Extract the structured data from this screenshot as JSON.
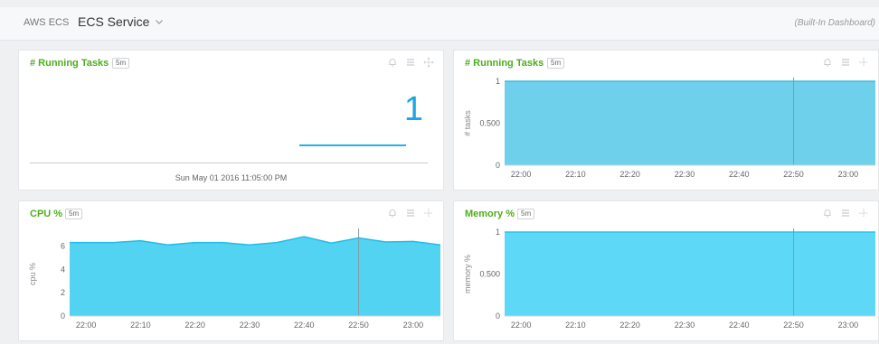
{
  "header": {
    "breadcrumb": "AWS ECS",
    "service": "ECS Service",
    "dashboard_type": "(Built-In Dashboard)"
  },
  "panels": {
    "running_tasks_value": {
      "title": "# Running Tasks",
      "interval": "5m",
      "value": "1",
      "timestamp": "Sun May 01 2016 11:05:00 PM"
    },
    "running_tasks_chart": {
      "title": "# Running Tasks",
      "interval": "5m"
    },
    "cpu_chart": {
      "title": "CPU %",
      "interval": "5m"
    },
    "memory_chart": {
      "title": "Memory %",
      "interval": "5m"
    }
  },
  "colors": {
    "title_green": "#4cae1c",
    "value_blue": "#1fa4e0",
    "area_tasks": "#6fd0ec",
    "area_cpu": "#52d3f2",
    "area_memory": "#5ed8f7"
  },
  "chart_data": [
    {
      "type": "area",
      "id": "running_tasks",
      "title": "# Running Tasks",
      "ylabel": "# tasks",
      "x": [
        "22:00",
        "22:10",
        "22:20",
        "22:30",
        "22:40",
        "22:50",
        "23:00"
      ],
      "xlim": [
        "21:57",
        "23:05"
      ],
      "ylim": [
        0,
        1
      ],
      "yticks": [
        0,
        0.5,
        1
      ],
      "ytick_labels": [
        "0",
        "0.500",
        "1"
      ],
      "series": [
        {
          "x": [
            "21:57",
            "23:05"
          ],
          "values": [
            1,
            1
          ]
        }
      ],
      "marker_x": "22:50",
      "grid": true
    },
    {
      "type": "area",
      "id": "cpu",
      "title": "CPU %",
      "ylabel": "cpu %",
      "x": [
        "22:00",
        "22:10",
        "22:20",
        "22:30",
        "22:40",
        "22:50",
        "23:00"
      ],
      "xlim": [
        "21:57",
        "23:05"
      ],
      "ylim": [
        0,
        7.2
      ],
      "yticks": [
        0,
        2,
        4,
        6
      ],
      "ytick_labels": [
        "0",
        "2",
        "4",
        "6"
      ],
      "series": [
        {
          "x": [
            "21:57",
            "22:05",
            "22:10",
            "22:15",
            "22:20",
            "22:25",
            "22:30",
            "22:35",
            "22:40",
            "22:45",
            "22:50",
            "22:55",
            "23:00",
            "23:05"
          ],
          "values": [
            6.3,
            6.3,
            6.45,
            6.1,
            6.3,
            6.3,
            6.1,
            6.3,
            6.8,
            6.25,
            6.7,
            6.35,
            6.4,
            6.1
          ]
        }
      ],
      "marker_x": "22:50",
      "grid": true
    },
    {
      "type": "area",
      "id": "memory",
      "title": "Memory %",
      "ylabel": "memory %",
      "x": [
        "22:00",
        "22:10",
        "22:20",
        "22:30",
        "22:40",
        "22:50",
        "23:00"
      ],
      "xlim": [
        "21:57",
        "23:05"
      ],
      "ylim": [
        0,
        1
      ],
      "yticks": [
        0,
        0.5,
        1
      ],
      "ytick_labels": [
        "0",
        "0.500",
        "1"
      ],
      "series": [
        {
          "x": [
            "21:57",
            "23:05"
          ],
          "values": [
            1,
            1
          ]
        }
      ],
      "marker_x": "22:50",
      "grid": true
    }
  ]
}
